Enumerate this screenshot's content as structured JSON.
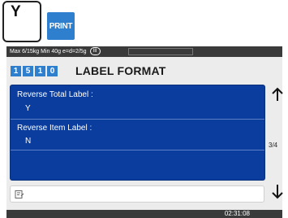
{
  "keys": {
    "y_key": "Y",
    "print_key": "PRINT"
  },
  "status_bar": {
    "scale_spec": "Max 6/15kg Min 40g e=d=2/5g",
    "range_badge": "III"
  },
  "header": {
    "code_digits": [
      "1",
      "5",
      "1",
      "0"
    ],
    "title": "LABEL FORMAT"
  },
  "fields": [
    {
      "label": "Reverse Total Label :",
      "value": "Y"
    },
    {
      "label": "Reverse Item Label  :",
      "value": "N"
    }
  ],
  "pager": {
    "indicator": "3/4"
  },
  "input": {
    "icon": "edit-note-icon",
    "value": ""
  },
  "footer": {
    "time": "02:31:08"
  },
  "colors": {
    "panel_bg": "#0a3d9e",
    "accent": "#2f7fcf",
    "bar": "#3a3a3a"
  }
}
